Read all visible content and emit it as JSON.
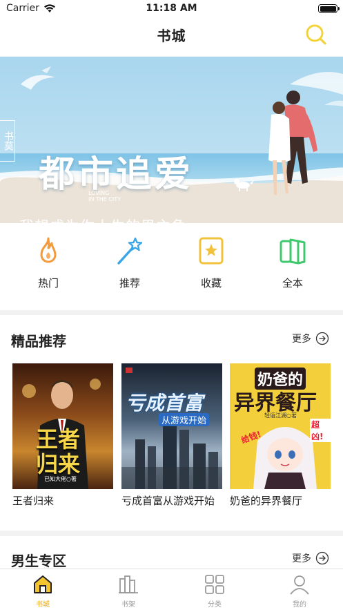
{
  "status": {
    "carrier": "Carrier",
    "time": "11:18 AM"
  },
  "nav": {
    "title": "书城"
  },
  "banner": {
    "title": "都市追爱",
    "subtitle_en_1": "LOVING",
    "subtitle_en_2": "IN THE CITY",
    "subtitle": "我想成为你人生的男主角",
    "stamp": "书莫"
  },
  "categories": [
    {
      "label": "热门",
      "icon": "flame-icon",
      "color": "#f39a3c"
    },
    {
      "label": "推荐",
      "icon": "magic-wand-icon",
      "color": "#3aa6e8"
    },
    {
      "label": "收藏",
      "icon": "star-icon",
      "color": "#f2c23c"
    },
    {
      "label": "全本",
      "icon": "book-stack-icon",
      "color": "#3fc86e"
    }
  ],
  "featured": {
    "title": "精品推荐",
    "more": "更多",
    "books": [
      {
        "title": "王者归来",
        "cover_text": "王者归来",
        "cover_author": "已知大佬○著"
      },
      {
        "title": "亏成首富从游戏开始",
        "cover_text": "亏成首富",
        "cover_sub": "从游戏开始"
      },
      {
        "title": "奶爸的异界餐厅",
        "cover_text_1": "奶爸的",
        "cover_text_2": "异界餐厅",
        "cover_author": "轻语江湖○著",
        "cover_tag_1": "超凶!",
        "cover_tag_2": "给钱!"
      }
    ]
  },
  "male_zone": {
    "title": "男生专区",
    "more": "更多"
  },
  "tabs": [
    {
      "label": "书城",
      "icon": "home-icon",
      "active": true
    },
    {
      "label": "书架",
      "icon": "bookshelf-icon",
      "active": false
    },
    {
      "label": "分类",
      "icon": "grid-icon",
      "active": false
    },
    {
      "label": "我的",
      "icon": "user-icon",
      "active": false
    }
  ],
  "colors": {
    "accent": "#f0a800",
    "search": "#f2d43a"
  }
}
